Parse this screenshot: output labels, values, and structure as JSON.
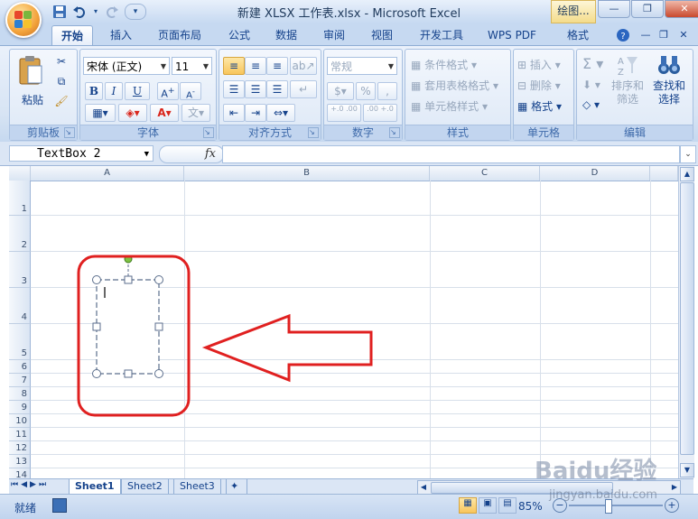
{
  "app": {
    "title": "新建 XLSX 工作表.xlsx - Microsoft Excel",
    "contextual_tab": "绘图...",
    "qat": [
      "save-icon",
      "undo-icon",
      "redo-icon",
      "customize-icon"
    ]
  },
  "ribbon": {
    "tabs": [
      "开始",
      "插入",
      "页面布局",
      "公式",
      "数据",
      "审阅",
      "视图",
      "开发工具",
      "WPS PDF",
      "格式"
    ],
    "active_tab": "开始",
    "groups": {
      "clipboard": {
        "label": "剪贴板",
        "paste": "粘贴"
      },
      "font": {
        "label": "字体",
        "font_name": "宋体 (正文)",
        "font_size": "11",
        "bold": "B",
        "italic": "I",
        "underline": "U"
      },
      "alignment": {
        "label": "对齐方式"
      },
      "number": {
        "label": "数字",
        "format": "常规",
        "percent": "%",
        "comma": ",",
        "inc_dec": "+.0 .00",
        "dec_dec": ".00 +.0"
      },
      "styles": {
        "label": "样式",
        "conditional": "条件格式",
        "table": "套用表格格式",
        "cell_styles": "单元格样式"
      },
      "cells": {
        "label": "单元格",
        "insert": "插入",
        "delete": "删除",
        "format": "格式"
      },
      "editing": {
        "label": "编辑",
        "sum": "Σ",
        "sort_filter": "排序和筛选",
        "find_select": "查找和选择"
      }
    }
  },
  "formula_bar": {
    "name_box": "TextBox 2",
    "fx": "fx",
    "value": ""
  },
  "grid": {
    "columns": [
      "A",
      "B",
      "C",
      "D"
    ],
    "rows": [
      "1",
      "2",
      "3",
      "4",
      "5",
      "6",
      "7",
      "8",
      "9",
      "10",
      "11",
      "12",
      "13",
      "14"
    ]
  },
  "sheets": {
    "tabs": [
      "Sheet1",
      "Sheet2",
      "Sheet3"
    ],
    "active": "Sheet1"
  },
  "status": {
    "mode": "就绪",
    "zoom": "85%"
  },
  "watermark": {
    "brand": "Baidu经验",
    "url": "jingyan.baidu.com"
  },
  "colors": {
    "accent": "#15428b",
    "annotation_red": "#e02020",
    "ribbon_bg": "#d7e4f4"
  }
}
